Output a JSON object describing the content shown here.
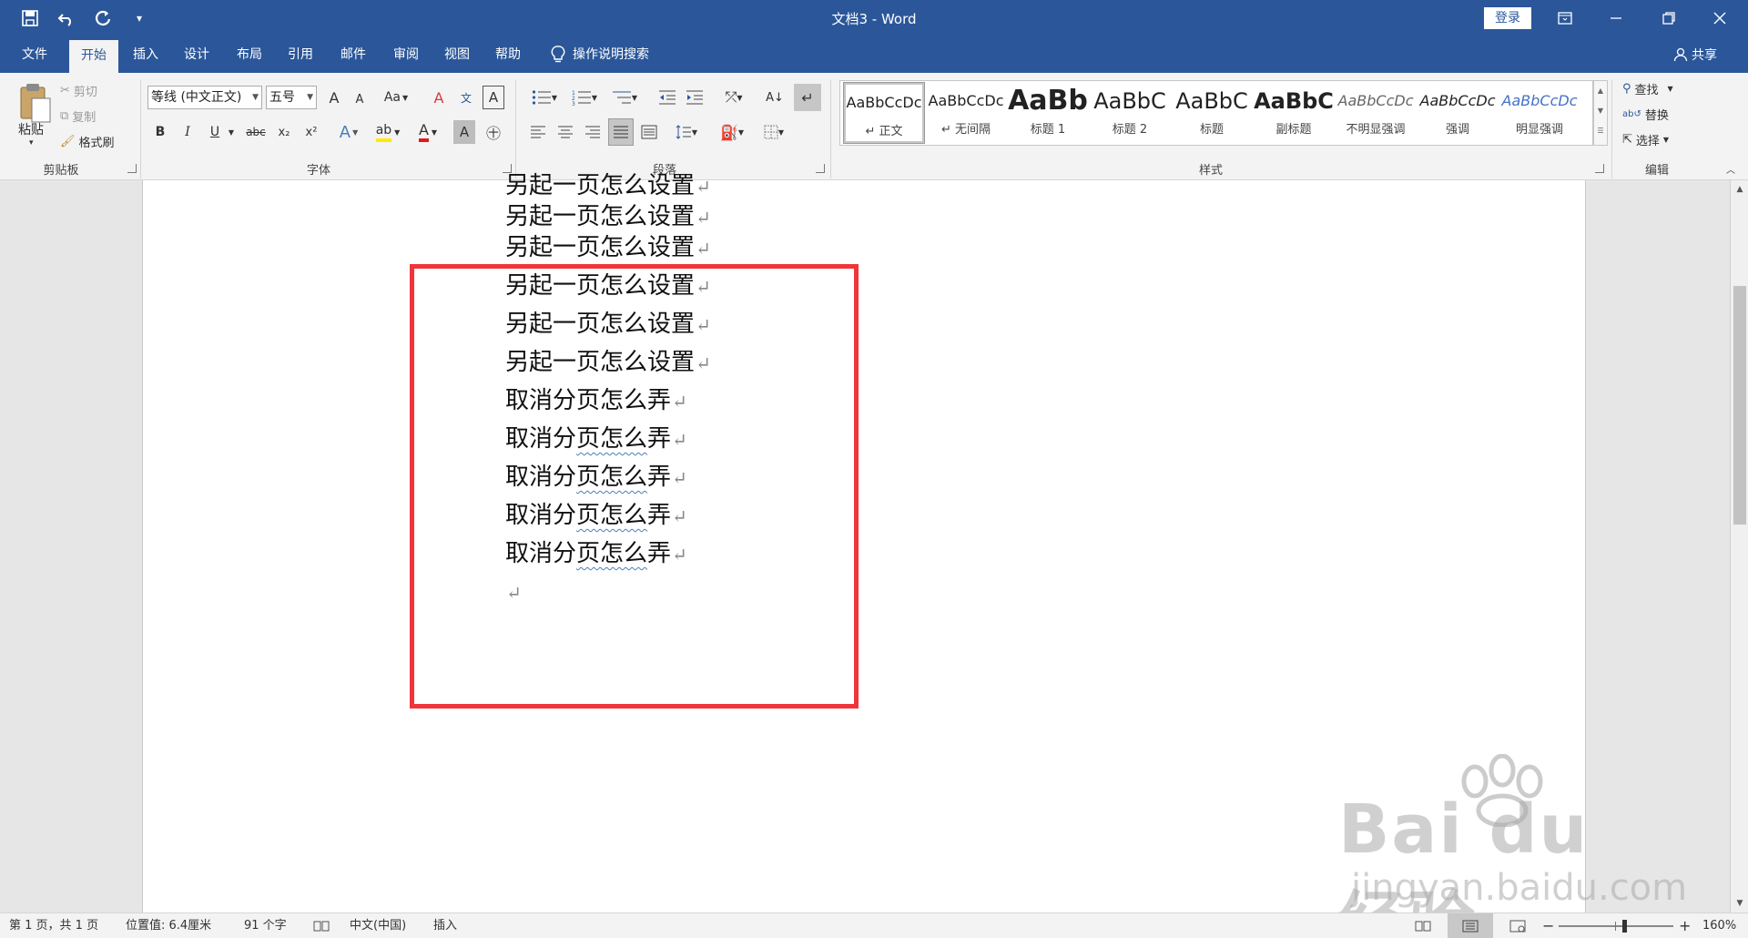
{
  "window": {
    "title": "文档3  -  Word",
    "login_label": "登录"
  },
  "tabs": [
    "文件",
    "开始",
    "插入",
    "设计",
    "布局",
    "引用",
    "邮件",
    "审阅",
    "视图",
    "帮助"
  ],
  "active_tab": "开始",
  "tell_me": "操作说明搜索",
  "share_label": "共享",
  "clipboard": {
    "paste": "粘贴",
    "cut": "剪切",
    "copy": "复制",
    "format_painter": "格式刷",
    "group_label": "剪贴板"
  },
  "font": {
    "font_name": "等线 (中文正文)",
    "font_size": "五号",
    "grow": "A",
    "shrink": "A",
    "case": "Aa",
    "bold": "B",
    "italic": "I",
    "underline": "U",
    "strike": "abc",
    "subscript": "x₂",
    "superscript": "x²",
    "group_label": "字体"
  },
  "paragraph": {
    "group_label": "段落"
  },
  "styles": {
    "group_label": "样式",
    "items": [
      {
        "preview": "AaBbCcDc",
        "name": "↵ 正文"
      },
      {
        "preview": "AaBbCcDc",
        "name": "↵ 无间隔"
      },
      {
        "preview": "AaBb",
        "name": "标题 1"
      },
      {
        "preview": "AaBbC",
        "name": "标题 2"
      },
      {
        "preview": "AaBbC",
        "name": "标题"
      },
      {
        "preview": "AaBbC",
        "name": "副标题"
      },
      {
        "preview": "AaBbCcDc",
        "name": "不明显强调"
      },
      {
        "preview": "AaBbCcDc",
        "name": "强调"
      },
      {
        "preview": "AaBbCcDc",
        "name": "明显强调"
      }
    ]
  },
  "editing": {
    "find": "查找",
    "replace": "替换",
    "select": "选择",
    "group_label": "编辑"
  },
  "document": {
    "lines": [
      "另起一页怎么设置",
      "另起一页怎么设置",
      "另起一页怎么设置",
      "另起一页怎么设置",
      "另起一页怎么设置",
      "另起一页怎么设置",
      "取消分页怎么弄",
      "取消分",
      "取消分",
      "取消分",
      "取消分"
    ],
    "underlined_part": "页怎么",
    "tail": "弄"
  },
  "watermark": {
    "brand": "Bai du 经验",
    "url": "jingyan.baidu.com"
  },
  "statusbar": {
    "page": "第 1 页，共 1 页",
    "position": "位置值: 6.4厘米",
    "words": "91 个字",
    "language": "中文(中国)",
    "mode": "插入",
    "zoom": "160%"
  },
  "colors": {
    "brand": "#2b579a",
    "highlight_box": "#f0353b"
  }
}
